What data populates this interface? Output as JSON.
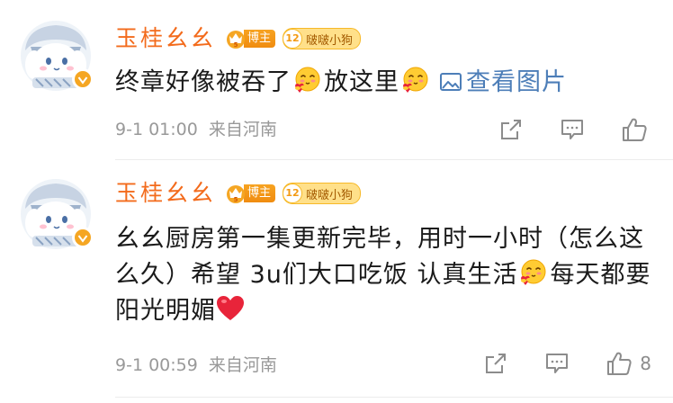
{
  "comments": [
    {
      "username": "玉桂幺幺",
      "role_badge": "博主",
      "fan_badge_level": "12",
      "fan_badge_name": "啵啵小狗",
      "content": {
        "part1": "终章好像被吞了",
        "part2": "放这里",
        "view_image": "查看图片"
      },
      "time": "9-1 01:00",
      "source": "来自河南",
      "like_count": ""
    },
    {
      "username": "玉桂幺幺",
      "role_badge": "博主",
      "fan_badge_level": "12",
      "fan_badge_name": "啵啵小狗",
      "content": {
        "part1": "幺幺厨房第一集更新完毕，用时一小时（怎么这么久）希望 3u们大口吃饭 认真生活",
        "part2": "每天都要阳光明媚"
      },
      "time": "9-1 00:59",
      "source": "来自河南",
      "like_count": "8"
    }
  ],
  "icons": {
    "avatar": "cinnamoroll-avatar",
    "verified": "verified-icon",
    "emoji": "heart-hug-emoji",
    "heart": "red-heart-emoji",
    "share": "share-icon",
    "reply": "comment-icon",
    "like": "thumbs-up-icon"
  },
  "colors": {
    "username": "#f36b1c",
    "link": "#4d7eb8",
    "meta": "#999999",
    "badge": "#f7a321"
  }
}
